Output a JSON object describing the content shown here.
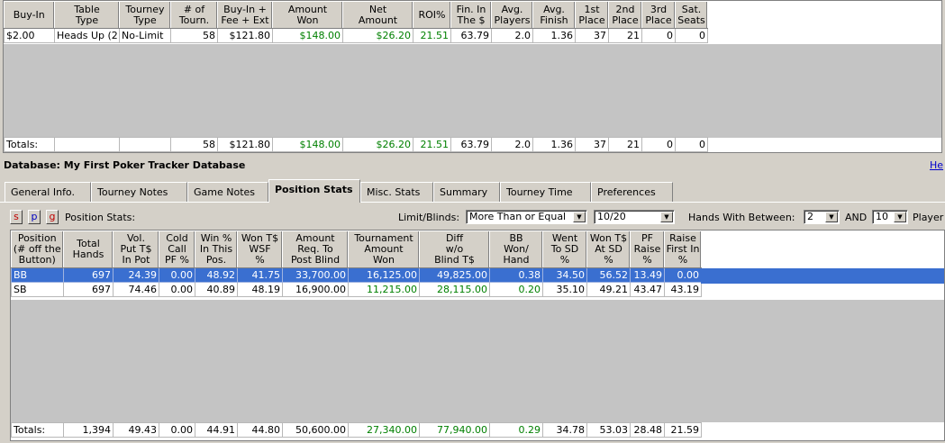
{
  "top_table": {
    "columns": [
      "Buy-In",
      "Table\nType",
      "Tourney\nType",
      "# of\nTourn.",
      "Buy-In +\nFee + Ext",
      "Amount\nWon",
      "Net\nAmount",
      "ROI%",
      "Fin. In\nThe $",
      "Avg.\nPlayers",
      "Avg.\nFinish",
      "1st\nPlace",
      "2nd\nPlace",
      "3rd\nPlace",
      "Sat.\nSeats"
    ],
    "rows": [
      [
        "$2.00",
        "Heads Up (2",
        "No-Limit",
        "58",
        "$121.80",
        "$148.00",
        "$26.20",
        "21.51",
        "63.79",
        "2.0",
        "1.36",
        "37",
        "21",
        "0",
        "0"
      ]
    ],
    "totals": [
      "Totals:",
      "",
      "",
      "58",
      "$121.80",
      "$148.00",
      "$26.20",
      "21.51",
      "63.79",
      "2.0",
      "1.36",
      "37",
      "21",
      "0",
      "0"
    ]
  },
  "database_label": "Database: My First Poker Tracker Database",
  "help_link": "He",
  "tabs": [
    "General Info.",
    "Tourney Notes",
    "Game Notes",
    "Position Stats",
    "Misc. Stats",
    "Summary",
    "Tourney Time",
    "Preferences"
  ],
  "active_tab": "Position Stats",
  "toolbar": {
    "btn_s": "s",
    "btn_p": "p",
    "btn_g": "g",
    "section_label": "Position Stats:",
    "limit_label": "Limit/Blinds:",
    "limit_mode": "More Than or Equal",
    "limit_value": "10/20",
    "hands_label": "Hands With Between:",
    "hands_min": "2",
    "and_label": "AND",
    "hands_max": "10",
    "players_label": "Player"
  },
  "position_table": {
    "columns": [
      "Position\n(# off the\nButton)",
      "Total\nHands",
      "Vol.\nPut T$\nIn Pot",
      "Cold\nCall\nPF %",
      "Win %\nIn This\nPos.",
      "Won T$\nWSF\n%",
      "Amount\nReq. To\nPost Blind",
      "Tournament\nAmount\nWon",
      "Diff\nw/o\nBlind T$",
      "BB\nWon/\nHand",
      "Went\nTo SD\n%",
      "Won T$\nAt SD\n%",
      "PF\nRaise\n%",
      "Raise\nFirst In\n%"
    ],
    "rows": [
      [
        "BB",
        "697",
        "24.39",
        "0.00",
        "48.92",
        "41.75",
        "33,700.00",
        "16,125.00",
        "49,825.00",
        "0.38",
        "34.50",
        "56.52",
        "13.49",
        "0.00"
      ],
      [
        "SB",
        "697",
        "74.46",
        "0.00",
        "40.89",
        "48.19",
        "16,900.00",
        "11,215.00",
        "28,115.00",
        "0.20",
        "35.10",
        "49.21",
        "43.47",
        "43.19"
      ]
    ],
    "totals": [
      "Totals:",
      "1,394",
      "49.43",
      "0.00",
      "44.91",
      "44.80",
      "50,600.00",
      "27,340.00",
      "77,940.00",
      "0.29",
      "34.78",
      "53.03",
      "28.48",
      "21.59"
    ]
  },
  "colors": {
    "positive": "#008000",
    "selection": "#3a6fd0",
    "chrome": "#d4d0c8",
    "link": "#0000cc"
  }
}
